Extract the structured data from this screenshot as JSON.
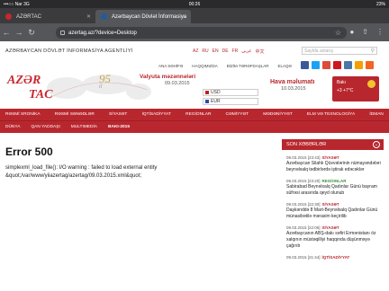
{
  "status": {
    "carrier": "•••○○ Nar 3G",
    "time": "00:26",
    "battery": "23%"
  },
  "tabs": [
    {
      "label": "AZƏRTAC",
      "close": "✕"
    },
    {
      "label": "Azərbaycan Dövlət İnformasiya",
      "close": "✕"
    }
  ],
  "omnibox": {
    "url": "azertag.az/?device=Desktop"
  },
  "site": {
    "agency": "AZƏRBAYCAN DÖVLƏT İNFORMASİYA AGENTLİYİ",
    "langs": [
      "AZ",
      "RU",
      "EN",
      "DE",
      "FR",
      "عربي",
      "中文"
    ],
    "search_placeholder": "Saytda axtarış",
    "nav": [
      "ANA SƏHİFƏ",
      "HAQQIMIZDA",
      "BİZİM TƏRƏFDAŞLAR",
      "ELAQƏ"
    ],
    "logo_top": "AZƏR",
    "logo_bottom": "TAC",
    "anniv": "95",
    "anniv_sub": "il",
    "fx_title": "Valyuta məzənnələri",
    "fx_date": "09.03.2015",
    "fx_usd": "USD",
    "fx_eur": "EUR",
    "weather_title": "Hava məlumatı",
    "weather_date": "10.03.2015",
    "city": "Bakı",
    "temp": "+3  +7°C",
    "menu1": [
      "RƏSMİ XRONİKA",
      "RƏSMİ SƏNƏDLƏR",
      "SİYASƏT",
      "İQTİSADİYYAT",
      "REGİONLAR",
      "CƏMİYYƏT",
      "MƏDƏNİYYƏT",
      "ELM VƏ TEXNOLOGİYA",
      "İDMAN"
    ],
    "menu2": [
      "DÜNYA",
      "QAN YADDAŞI",
      "MULTIMEDİA",
      "BAKI-2015"
    ]
  },
  "error": {
    "title": "Error 500",
    "message": "simplexml_load_file(): I/O warning : failed to load external entity &quot;/var/www/yiiazertag/azertag/09.03.2015.xml&quot;"
  },
  "news": {
    "header": "SON XƏBƏRLƏR",
    "items": [
      {
        "time": "09.03.2015 [23:43]",
        "cat": "SİYASƏT",
        "cat_color": "red",
        "text": "Azərbaycan Silahlı Qüvvələrinin nümayəndələri beynəlxalq tədbirlərdə iştirak edəcəklər"
      },
      {
        "time": "09.03.2015 [23:20]",
        "cat": "REGİONLAR",
        "cat_color": "green",
        "text": "Sabirabad Beynəlxalq Qadınlar Günü bayram süfrəsi arasında qeyd olunub"
      },
      {
        "time": "09.03.2015 [22:30]",
        "cat": "SİYASƏT",
        "cat_color": "red",
        "text": "Daşkənddə 8 Mart-Beynəlxalq Qadınlar Günü münasibətilə mərasim keçirilib"
      },
      {
        "time": "09.03.2015 [22:06]",
        "cat": "SİYASƏT",
        "cat_color": "red",
        "text": "Azərbaycanın ABŞ-dakı səfiri Ermənistanı öz xalqının müstəqilliyi haqqında düşünməyə çağırıb"
      },
      {
        "time": "09.03.2015 [21:44]",
        "cat": "İQTİSADİYYAT",
        "cat_color": "red",
        "text": ""
      }
    ]
  }
}
